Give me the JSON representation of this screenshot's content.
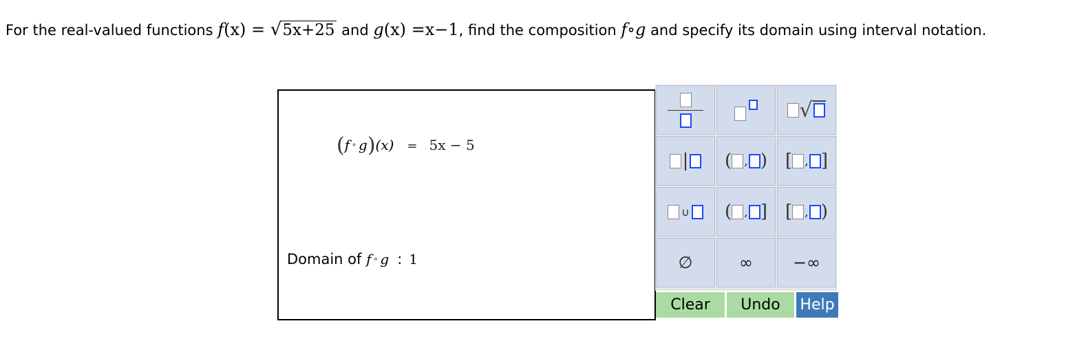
{
  "question": {
    "part1": "For the real-valued functions ",
    "f_label": "f",
    "f_arg": "(x) = ",
    "f_radicand": "5x+25",
    "part2": " and ",
    "g_label": "g",
    "g_arg": "(x) =x−1",
    "part3": ", find the composition ",
    "composition": "f∘g",
    "part4": " and specify its domain using interval notation."
  },
  "answer": {
    "comp_lparen": "(",
    "comp_f": "f",
    "comp_ring": "∘",
    "comp_g": "g",
    "comp_rparen": ")",
    "comp_x": "(x)",
    "comp_equals": "=",
    "comp_value": "5x − 5",
    "domain_label": "Domain of ",
    "domain_f": "f",
    "domain_ring": "∘",
    "domain_g": "g",
    "domain_colon": ":",
    "domain_value": "1"
  },
  "palette": {
    "pipe": "|",
    "comma": ",",
    "lparen": "(",
    "rparen": ")",
    "lbracket": "[",
    "rbracket": "]",
    "union": "∪",
    "empty_set": "∅",
    "infinity": "∞",
    "neg_infinity": "−∞",
    "icons": [
      "fraction-icon",
      "exponent-icon",
      "nth-root-icon",
      "absolute-value-icon",
      "open-interval-icon",
      "closed-interval-icon",
      "union-icon",
      "left-open-interval-icon",
      "right-open-interval-icon",
      "empty-set-icon",
      "infinity-icon",
      "negative-infinity-icon"
    ]
  },
  "buttons": {
    "clear": "Clear",
    "undo": "Undo",
    "help": "Help"
  },
  "colors": {
    "palette_bg": "#d3dcec",
    "placeholder_blue": "#1c48ff",
    "clear_undo_bg": "#a9dba2",
    "help_bg": "#3f7ab8"
  }
}
